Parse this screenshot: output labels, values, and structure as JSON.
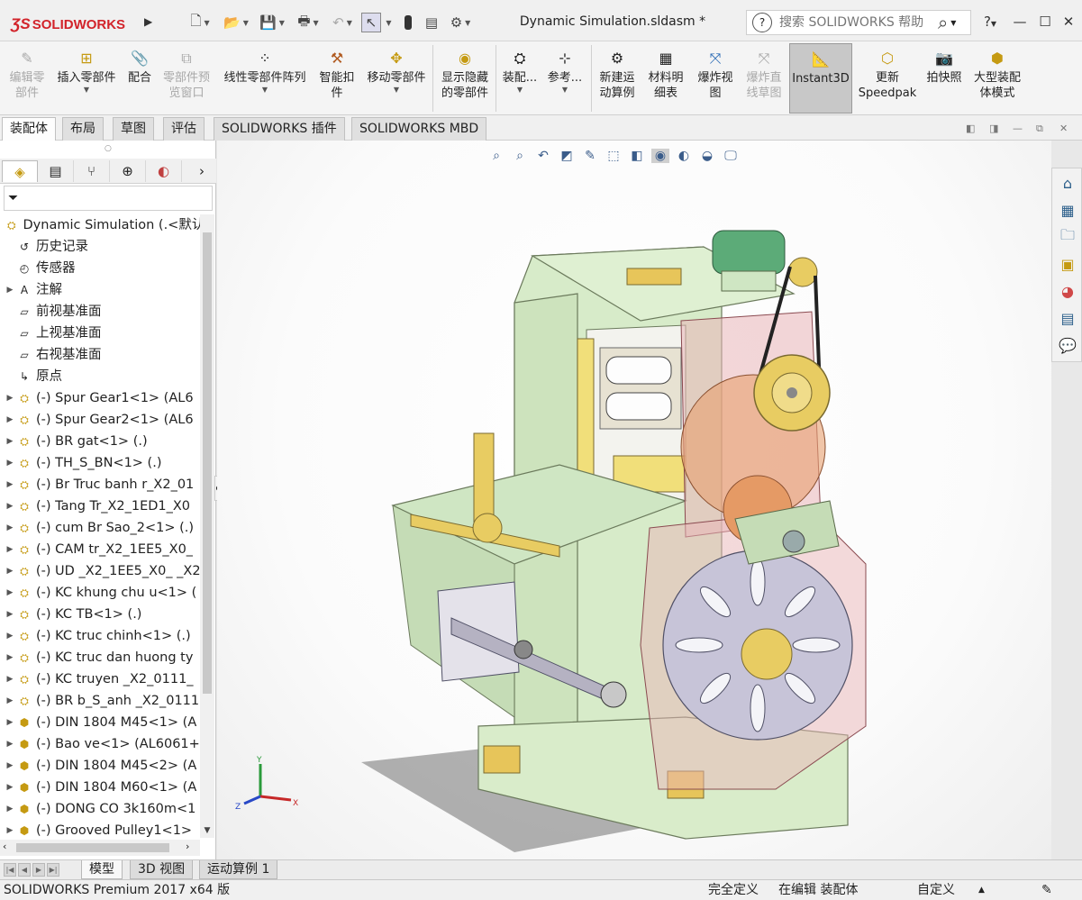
{
  "app": {
    "logo_text": "SOLIDWORKS",
    "document_title": "Dynamic Simulation.sldasm *",
    "search_placeholder": "搜索 SOLIDWORKS 帮助",
    "help_label": "?"
  },
  "colors": {
    "brand_red": "#d2232a",
    "frame_green": "#cfe6c3",
    "housing_pink": "#e9b5b8",
    "gear_gold": "#e8cc62",
    "disc_lavender": "#c7c4d8"
  },
  "command_manager": {
    "items": [
      {
        "label": "编辑零\n部件",
        "icon": "edit-component-icon",
        "disabled": true
      },
      {
        "label": "插入零部件",
        "icon": "insert-component-icon",
        "dropdown": true
      },
      {
        "label": "配合",
        "icon": "mate-icon"
      },
      {
        "label": "零部件预\n览窗口",
        "icon": "component-preview-icon",
        "disabled": true
      },
      {
        "label": "线性零部件阵列",
        "icon": "linear-pattern-icon",
        "dropdown": true
      },
      {
        "label": "智能扣\n件",
        "icon": "smart-fasteners-icon"
      },
      {
        "label": "移动零部件",
        "icon": "move-component-icon",
        "dropdown": true
      },
      {
        "label": "显示隐藏\n的零部件",
        "icon": "show-hidden-icon"
      },
      {
        "label": "装配...",
        "icon": "assembly-features-icon",
        "dropdown": true
      },
      {
        "label": "参考...",
        "icon": "reference-geometry-icon",
        "dropdown": true
      },
      {
        "label": "新建运\n动算例",
        "icon": "new-motion-study-icon"
      },
      {
        "label": "材料明\n细表",
        "icon": "bill-of-materials-icon"
      },
      {
        "label": "爆炸视\n图",
        "icon": "exploded-view-icon"
      },
      {
        "label": "爆炸直\n线草图",
        "icon": "explode-line-sketch-icon",
        "disabled": true
      },
      {
        "label": "Instant3D",
        "icon": "instant3d-icon",
        "active": true
      },
      {
        "label": "更新\nSpeedpak",
        "icon": "speedpak-icon"
      },
      {
        "label": "拍快照",
        "icon": "snapshot-icon"
      },
      {
        "label": "大型装配\n体模式",
        "icon": "large-assembly-icon"
      }
    ]
  },
  "tabs": [
    "装配体",
    "布局",
    "草图",
    "评估",
    "SOLIDWORKS 插件",
    "SOLIDWORKS MBD"
  ],
  "feature_tree": {
    "root": "Dynamic Simulation  (.<默认",
    "items": [
      {
        "label": "历史记录",
        "icon": "history-icon",
        "expandable": false
      },
      {
        "label": "传感器",
        "icon": "sensor-icon",
        "expandable": false
      },
      {
        "label": "注解",
        "icon": "annotation-icon",
        "expandable": true
      },
      {
        "label": "前视基准面",
        "icon": "plane-icon",
        "expandable": false
      },
      {
        "label": "上视基准面",
        "icon": "plane-icon",
        "expandable": false
      },
      {
        "label": "右视基准面",
        "icon": "plane-icon",
        "expandable": false
      },
      {
        "label": "原点",
        "icon": "origin-icon",
        "expandable": false
      },
      {
        "label": "(-) Spur Gear1<1> (AL6",
        "icon": "subassembly-icon",
        "expandable": true
      },
      {
        "label": "(-) Spur Gear2<1> (AL6",
        "icon": "subassembly-icon",
        "expandable": true
      },
      {
        "label": "(-) BR gat<1> (.)",
        "icon": "subassembly-icon",
        "expandable": true
      },
      {
        "label": "(-) TH_S_BN<1> (.)",
        "icon": "subassembly-icon",
        "expandable": true
      },
      {
        "label": "(-) Br Truc banh r_X2_01",
        "icon": "subassembly-icon",
        "expandable": true
      },
      {
        "label": "(-) Tang Tr_X2_1ED1_X0",
        "icon": "subassembly-icon",
        "expandable": true
      },
      {
        "label": "(-) cum Br Sao_2<1> (.)",
        "icon": "subassembly-icon",
        "expandable": true
      },
      {
        "label": "(-) CAM tr_X2_1EE5_X0_",
        "icon": "subassembly-icon",
        "expandable": true
      },
      {
        "label": "(-) UD _X2_1EE5_X0_ _X2",
        "icon": "subassembly-icon",
        "expandable": true
      },
      {
        "label": "(-) KC khung chu u<1> (",
        "icon": "subassembly-icon",
        "expandable": true
      },
      {
        "label": "(-) KC TB<1> (.)",
        "icon": "subassembly-icon",
        "expandable": true
      },
      {
        "label": "(-) KC truc chinh<1> (.)",
        "icon": "subassembly-icon",
        "expandable": true
      },
      {
        "label": "(-) KC truc dan huong ty",
        "icon": "subassembly-icon",
        "expandable": true
      },
      {
        "label": "(-) KC truyen _X2_0111_",
        "icon": "subassembly-icon",
        "expandable": true
      },
      {
        "label": "(-) BR b_S_anh _X2_0111",
        "icon": "subassembly-icon",
        "expandable": true
      },
      {
        "label": "(-) DIN 1804 M45<1> (A",
        "icon": "part-icon",
        "expandable": true
      },
      {
        "label": "(-) Bao ve<1> (AL6061+",
        "icon": "part-icon",
        "expandable": true
      },
      {
        "label": "(-) DIN 1804 M45<2> (A",
        "icon": "part-icon",
        "expandable": true
      },
      {
        "label": "(-) DIN 1804 M60<1> (A",
        "icon": "part-icon",
        "expandable": true
      },
      {
        "label": "(-) DONG CO 3k160m<1",
        "icon": "part-icon",
        "expandable": true
      },
      {
        "label": "(-) Grooved Pulley1<1>",
        "icon": "part-icon",
        "expandable": true
      }
    ]
  },
  "triad": {
    "x": "X",
    "y": "Y",
    "z": "Z"
  },
  "bottom_tabs": [
    "模型",
    "3D 视图",
    "运动算例 1"
  ],
  "status": {
    "product": "SOLIDWORKS Premium 2017 x64 版",
    "definition": "完全定义",
    "editing": "在编辑 装配体",
    "units": "自定义"
  }
}
